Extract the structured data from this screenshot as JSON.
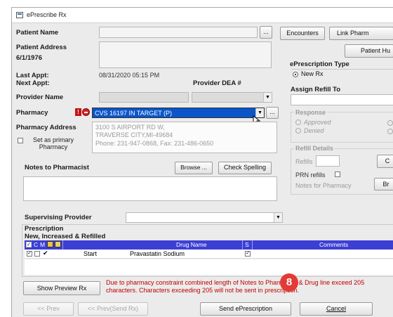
{
  "window": {
    "title": "ePrescribe Rx"
  },
  "patient": {
    "name_label": "Patient Name",
    "address_label": "Patient Address",
    "dob": "6/1/1976",
    "last_appt_label": "Last Appt:",
    "last_appt_value": "08/31/2020 05:15 PM",
    "next_appt_label": "Next Appt:",
    "provider_dea_label": "Provider DEA #",
    "provider_name_label": "Provider Name",
    "more_button": "..."
  },
  "top_buttons": {
    "encounters": "Encounters",
    "link_pharmacy": "Link Pharm",
    "patient_hub": "Patient Hu"
  },
  "eprescription_type": {
    "title": "ePrescription Type",
    "option": "New Rx"
  },
  "assign_refill": {
    "label": "Assign Refill To"
  },
  "pharmacy": {
    "label": "Pharmacy",
    "selected": "CVS 16197 IN TARGET (P)",
    "more_button": "...",
    "address_label": "Pharmacy Address",
    "address_lines": [
      "3100 S AIRPORT RD W,",
      "TRAVERSE CITY,MI-49684",
      "Phone: 231-947-0868, Fax: 231-486-0650"
    ],
    "set_primary_label": "Set as primary Pharmacy"
  },
  "response": {
    "title": "Response",
    "approved": "Approved",
    "denied": "Denied"
  },
  "refill_details": {
    "title": "Refill Details",
    "refills_label": "Refills",
    "prn_label": "PRN refills",
    "notes_label": "Notes for Pharmacy",
    "c_button": "C",
    "br_button": "Br"
  },
  "notes": {
    "label": "Notes to Pharmacist",
    "browse_button": "Browse ...",
    "spell_button": "Check Spelling"
  },
  "supervising": {
    "label": "Supervising Provider"
  },
  "prescription": {
    "title": "Prescription",
    "subtitle": "New, Increased & Refilled",
    "headers": {
      "c": "C",
      "m": "M",
      "drug": "Drug Name",
      "s": "S",
      "comments": "Comments"
    },
    "rows": [
      {
        "action": "Start",
        "drug": "Pravastatin Sodium"
      }
    ]
  },
  "bottom": {
    "show_preview": "Show Preview Rx",
    "warning": "Due to pharmacy constraint combined length of Notes to Pharmacist & Drug line exceed 205 characters. Characters exceeding 205 will not be sent in prescription.",
    "badge": "8",
    "prev": "<< Prev",
    "prev_send": "<< Prev(Send Rx)",
    "send": "Send ePrescription",
    "cancel": "Cancel"
  },
  "colors": {
    "selection": "#0a55c9",
    "badge": "#e23b35",
    "grid_header": "#3c3fd4",
    "warning": "#c00000"
  }
}
